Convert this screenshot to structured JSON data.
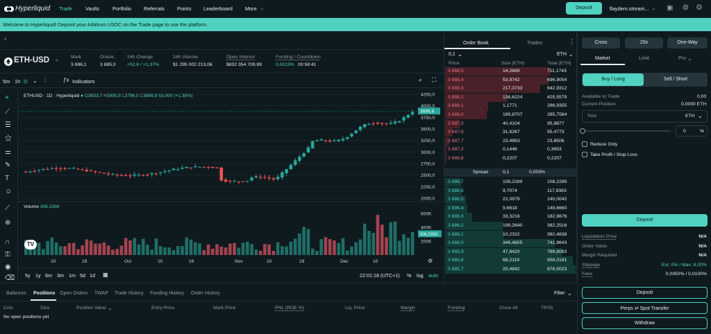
{
  "nav": {
    "logo": "Hyperliquid",
    "items": [
      "Trade",
      "Vaults",
      "Portfolio",
      "Referrals",
      "Points",
      "Leaderboard",
      "More"
    ],
    "deposit": "Deposit",
    "wallet": "flaydem.stream..."
  },
  "banner": "Welcome to Hyperliquid! Deposit your Arbitrum USDC on the Trade page to use the platform.",
  "market": {
    "symbol": "ETH-USD",
    "stats": [
      {
        "label": "Mark",
        "value": "3 886,1"
      },
      {
        "label": "Oracle",
        "value": "3 885,0"
      },
      {
        "label": "24h Change",
        "value": "+52,6 / +1,37%"
      },
      {
        "label": "24h Volume",
        "value": "$1 295 002 213,06"
      },
      {
        "label": "Open Interest",
        "value": "$832 354 709,99"
      },
      {
        "label": "Funding / Countdown",
        "value": "0,0013%",
        "value2": "00:58:41"
      }
    ]
  },
  "chart": {
    "intervals": [
      "5m",
      "1h",
      "D"
    ],
    "indicators": "Indicators",
    "legend": {
      "title": "ETHUSD · 1D · Hyperliquid",
      "O": "3833,7",
      "H": "3990,5",
      "L": "3796,0",
      "C": "3886,8",
      "chg": "53,000 (+1,38%)"
    },
    "price_ticks": [
      "4250,0",
      "4000,0",
      "3750,0",
      "3500,0",
      "3250,0",
      "3000,0",
      "2750,0",
      "2500,0",
      "2250,0",
      "2000,0"
    ],
    "last_price": "3886,8",
    "volume_label": "Volume",
    "volume_value": "306,335K",
    "vol_ticks": [
      "600K",
      "400K",
      "200K"
    ],
    "vol_last": "306,335K",
    "date_ticks": [
      "10",
      "19",
      "Oct",
      "10",
      "19",
      "Nov",
      "10",
      "19",
      "Dec",
      "10"
    ],
    "ranges": [
      "5y",
      "1y",
      "6m",
      "3m",
      "1m",
      "5d",
      "1d"
    ],
    "time": "22:01:18 (UTC+1)",
    "pct": "%",
    "log": "log",
    "auto": "auto"
  },
  "chart_data": {
    "type": "candlestick",
    "ylim": [
      2000,
      4250
    ],
    "vol_ylim": [
      0,
      700000
    ]
  },
  "orderbook": {
    "tabs": [
      "Order Book",
      "Trades"
    ],
    "tick": "0,1",
    "asset": "ETH",
    "headers": [
      "Price",
      "Size (ETH)",
      "Total (ETH)"
    ],
    "asks": [
      [
        "3 888,5",
        "14,2689",
        "711,1743"
      ],
      [
        "3 888,4",
        "53,9742",
        "696,9054"
      ],
      [
        "3 888,3",
        "217,3733",
        "642,9312"
      ],
      [
        "3 888,2",
        "138,6224",
        "425,5579"
      ],
      [
        "3 888,1",
        "1,1771",
        "286,9355"
      ],
      [
        "3 888,0",
        "189,8707",
        "285,7584"
      ],
      [
        "3 887,9",
        "40,4104",
        "95,8877"
      ],
      [
        "3 887,8",
        "31,6267",
        "55,4773"
      ],
      [
        "3 887,7",
        "23,4853",
        "23,8506"
      ],
      [
        "3 887,2",
        "0,1446",
        "0,3653"
      ],
      [
        "3 886,8",
        "0,2207",
        "0,2207"
      ]
    ],
    "spread": {
      "label": "Spread",
      "value": "0,1",
      "pct": "0,003%"
    },
    "bids": [
      [
        "3 886,7",
        "108,2289",
        "108,2289"
      ],
      [
        "3 886,6",
        "9,7074",
        "117,9363"
      ],
      [
        "3 886,5",
        "22,0679",
        "140,0042"
      ],
      [
        "3 886,4",
        "9,6618",
        "149,6660"
      ],
      [
        "3 886,3",
        "33,3216",
        "182,9876"
      ],
      [
        "3 886,2",
        "199,2640",
        "382,2516"
      ],
      [
        "3 886,1",
        "10,2322",
        "392,4838"
      ],
      [
        "3 886,0",
        "349,4805",
        "741,9643"
      ],
      [
        "3 885,9",
        "47,8420",
        "789,8063"
      ],
      [
        "3 885,8",
        "68,2118",
        "858,0181"
      ],
      [
        "3 885,7",
        "20,4842",
        "878,5023"
      ]
    ],
    "ask_depth": [
      0.81,
      0.79,
      0.73,
      0.48,
      0.33,
      0.32,
      0.11,
      0.06,
      0.03,
      0.01,
      0.01
    ],
    "bid_depth": [
      0.12,
      0.13,
      0.16,
      0.17,
      0.21,
      0.44,
      0.45,
      0.84,
      0.9,
      0.98,
      1.0
    ]
  },
  "order": {
    "margin_modes": [
      "Cross",
      "20x",
      "One-Way"
    ],
    "types": [
      "Market",
      "Limit",
      "Pro"
    ],
    "sides": [
      "Buy / Long",
      "Sell / Short"
    ],
    "available_label": "Available to Trade",
    "available": "0,00",
    "position_label": "Current Position",
    "position": "0,0000 ETH",
    "size_placeholder": "Size",
    "size_unit": "ETH",
    "pct_value": "0",
    "pct_unit": "%",
    "reduce_only": "Reduce Only",
    "tpsl": "Take Profit / Stop Loss",
    "deposit": "Deposit",
    "info": [
      {
        "label": "Liquidation Price",
        "value": "N/A"
      },
      {
        "label": "Order Value",
        "value": "N/A"
      },
      {
        "label": "Margin Required",
        "value": "N/A"
      },
      {
        "label": "Slippage",
        "value": "Est: 0% / Max: 8,00%"
      },
      {
        "label": "Fees",
        "value": "0,0350% / 0,0100%"
      }
    ],
    "bottom_buttons": [
      "Deposit",
      "Perps ⇄ Spot Transfer",
      "Withdraw"
    ]
  },
  "bottom": {
    "tabs": [
      "Balances",
      "Positions",
      "Open Orders",
      "TWAP",
      "Trade History",
      "Funding History",
      "Order History"
    ],
    "filter": "Filter",
    "columns": [
      "Coin",
      "Size",
      "Position Value",
      "Entry Price",
      "Mark Price",
      "PNL (ROE %)",
      "Liq. Price",
      "Margin",
      "Funding",
      "Close All",
      "TP/SL"
    ],
    "empty": "No open positions yet"
  },
  "colors": {
    "accent": "#50d2c1",
    "red": "#ed7088",
    "bg": "#0f1a1f"
  }
}
